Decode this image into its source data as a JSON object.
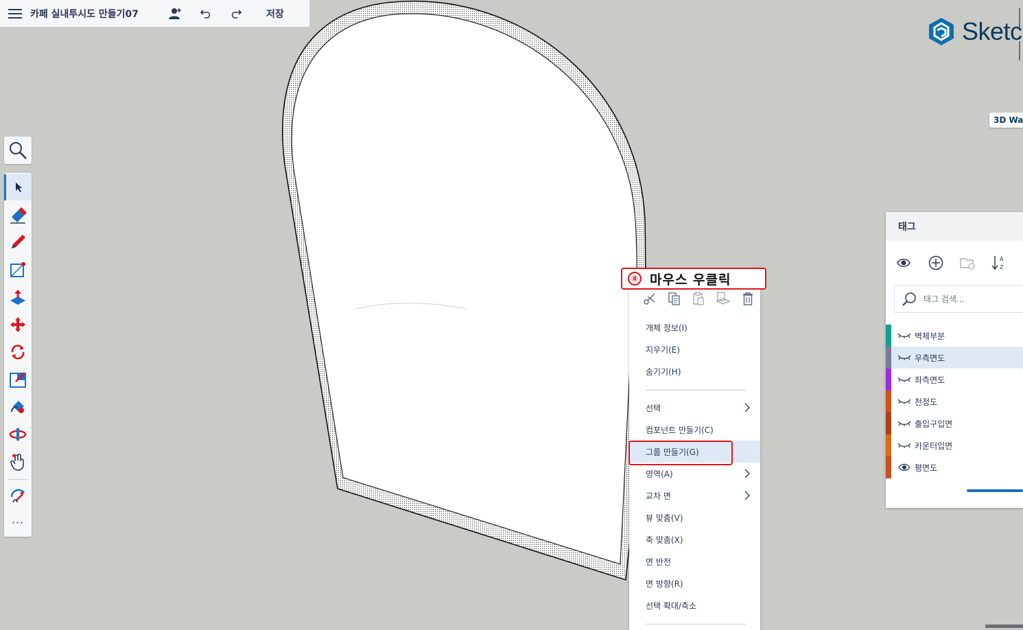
{
  "topbar": {
    "title": "카페 실내투시도 만들기07",
    "save_label": "저장"
  },
  "brand": {
    "wordmark": "Sketc",
    "badge_3d": "3D Wa"
  },
  "callout": {
    "number": "⑧",
    "text": "마우스 우클릭"
  },
  "context_menu": {
    "icons": [
      "scissors-icon",
      "copy-icon",
      "paste-icon",
      "paste-in-place-icon",
      "trash-icon"
    ],
    "items": [
      {
        "label": "개체 정보(I)"
      },
      {
        "label": "지우기(E)"
      },
      {
        "label": "숨기기(H)"
      },
      {
        "label": "선택"
      },
      {
        "label": "컴포넌트 만들기(C)"
      },
      {
        "label": "그룹 만들기(G)"
      },
      {
        "label": "영역(A)"
      },
      {
        "label": "교차 면"
      },
      {
        "label": "뷰 맞춤(V)"
      },
      {
        "label": "축 맞춤(X)"
      },
      {
        "label": "면 반전"
      },
      {
        "label": "면 방향(R)"
      },
      {
        "label": "선택 확대/축소"
      }
    ]
  },
  "tags_panel": {
    "title": "태그",
    "search_placeholder": "태그 검색...",
    "items": [
      {
        "name": "벽체부분",
        "color": "#12a08e"
      },
      {
        "name": "우측면도",
        "color": "#7d7a99"
      },
      {
        "name": "좌측면도",
        "color": "#9b2de0"
      },
      {
        "name": "천정도",
        "color": "#d0501a"
      },
      {
        "name": "출입구입면",
        "color": "#a8401a"
      },
      {
        "name": "카운터입면",
        "color": "#d86a1a"
      },
      {
        "name": "평면도",
        "color": "#c9501c"
      }
    ]
  }
}
